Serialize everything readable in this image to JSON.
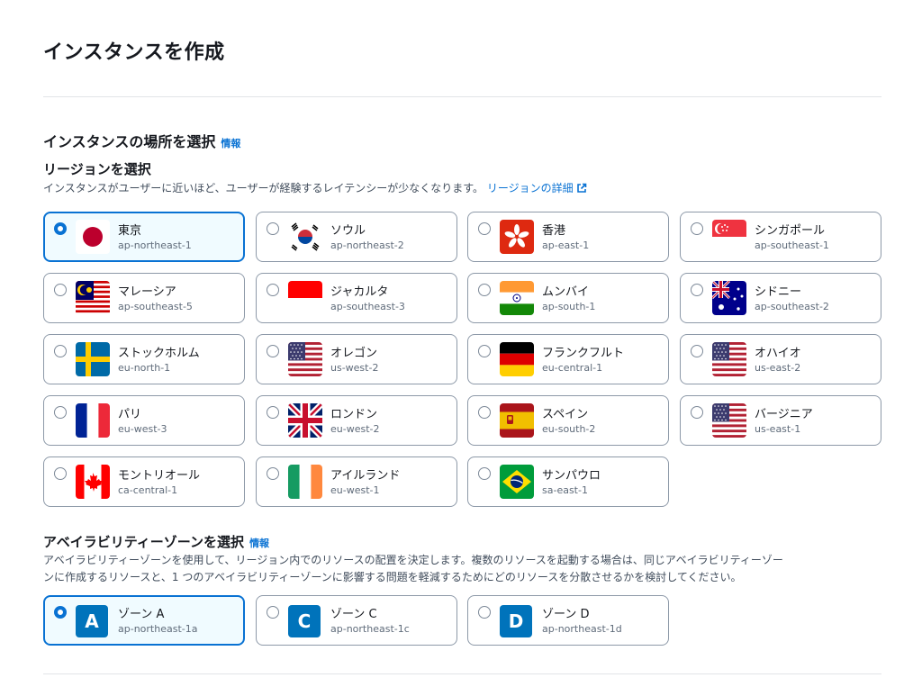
{
  "page": {
    "title": "インスタンスを作成"
  },
  "location": {
    "title": "インスタンスの場所を選択",
    "info": "情報"
  },
  "region": {
    "title": "リージョンを選択",
    "description": "インスタンスがユーザーに近いほど、ユーザーが経験するレイテンシーが少なくなります。",
    "details_link": "リージョンの詳細",
    "items": [
      {
        "name": "東京",
        "code": "ap-northeast-1",
        "flag": "japan-flag",
        "selected": true
      },
      {
        "name": "ソウル",
        "code": "ap-northeast-2",
        "flag": "south-korea-flag",
        "selected": false
      },
      {
        "name": "香港",
        "code": "ap-east-1",
        "flag": "hong-kong-flag",
        "selected": false
      },
      {
        "name": "シンガポール",
        "code": "ap-southeast-1",
        "flag": "singapore-flag",
        "selected": false
      },
      {
        "name": "マレーシア",
        "code": "ap-southeast-5",
        "flag": "malaysia-flag",
        "selected": false
      },
      {
        "name": "ジャカルタ",
        "code": "ap-southeast-3",
        "flag": "indonesia-flag",
        "selected": false
      },
      {
        "name": "ムンバイ",
        "code": "ap-south-1",
        "flag": "india-flag",
        "selected": false
      },
      {
        "name": "シドニー",
        "code": "ap-southeast-2",
        "flag": "australia-flag",
        "selected": false
      },
      {
        "name": "ストックホルム",
        "code": "eu-north-1",
        "flag": "sweden-flag",
        "selected": false
      },
      {
        "name": "オレゴン",
        "code": "us-west-2",
        "flag": "usa-flag",
        "selected": false
      },
      {
        "name": "フランクフルト",
        "code": "eu-central-1",
        "flag": "germany-flag",
        "selected": false
      },
      {
        "name": "オハイオ",
        "code": "us-east-2",
        "flag": "usa-flag",
        "selected": false
      },
      {
        "name": "パリ",
        "code": "eu-west-3",
        "flag": "france-flag",
        "selected": false
      },
      {
        "name": "ロンドン",
        "code": "eu-west-2",
        "flag": "uk-flag",
        "selected": false
      },
      {
        "name": "スペイン",
        "code": "eu-south-2",
        "flag": "spain-flag",
        "selected": false
      },
      {
        "name": "バージニア",
        "code": "us-east-1",
        "flag": "usa-flag",
        "selected": false
      },
      {
        "name": "モントリオール",
        "code": "ca-central-1",
        "flag": "canada-flag",
        "selected": false
      },
      {
        "name": "アイルランド",
        "code": "eu-west-1",
        "flag": "ireland-flag",
        "selected": false
      },
      {
        "name": "サンパウロ",
        "code": "sa-east-1",
        "flag": "brazil-flag",
        "selected": false
      }
    ]
  },
  "az": {
    "title": "アベイラビリティーゾーンを選択",
    "info": "情報",
    "description_line1": "アベイラビリティーゾーンを使用して、リージョン内でのリソースの配置を決定します。複数のリソースを起動する場合は、同じアベイラビリティーゾー",
    "description_line2": "ンに作成するリソースと、1 つのアベイラビリティーゾーンに影響する問題を軽減するためにどのリソースを分散させるかを検討してください。",
    "items": [
      {
        "letter": "A",
        "name": "ゾーン A",
        "code": "ap-northeast-1a",
        "selected": true
      },
      {
        "letter": "C",
        "name": "ゾーン C",
        "code": "ap-northeast-1c",
        "selected": false
      },
      {
        "letter": "D",
        "name": "ゾーン D",
        "code": "ap-northeast-1d",
        "selected": false
      }
    ]
  },
  "colors": {
    "accent": "#0972d3",
    "selected_bg": "#f0fbff",
    "zone_badge": "#0073bb"
  }
}
